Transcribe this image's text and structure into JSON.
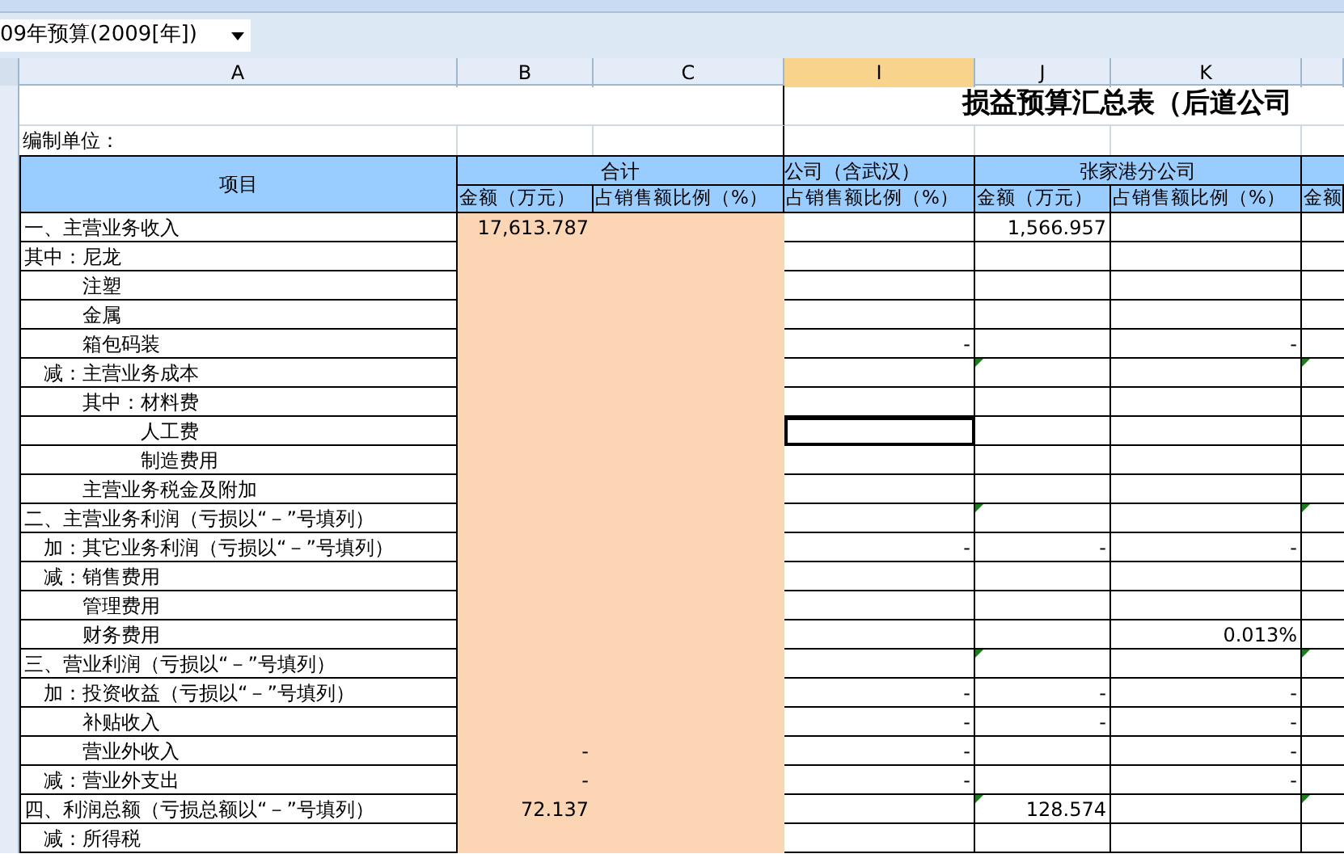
{
  "toolbar": {
    "period_dropdown": "09年预算(2009[年])"
  },
  "column_headers": [
    {
      "label": "A",
      "selected": false
    },
    {
      "label": "B",
      "selected": false
    },
    {
      "label": "C",
      "selected": false
    },
    {
      "label": "I",
      "selected": true
    },
    {
      "label": "J",
      "selected": false
    },
    {
      "label": "K",
      "selected": false
    }
  ],
  "sheet": {
    "title": "损益预算汇总表（后道公司",
    "unit_label": "编制单位：",
    "header": {
      "item": "项目",
      "groups": [
        "合计",
        "公司（含武汉）",
        "张家港分公司"
      ],
      "subheaders": [
        "金额（万元）",
        "占销售额比例（%）",
        "占销售额比例（%）",
        "金额（万元）",
        "占销售额比例（%）",
        "金额"
      ]
    },
    "rows": [
      {
        "item": "一、主营业务收入",
        "kind": "section",
        "flagged": false,
        "B": "17,613.787",
        "J": "1,566.957"
      },
      {
        "item": "其中：尼龙",
        "kind": "section",
        "flagged": false
      },
      {
        "item": "注塑",
        "kind": "detail",
        "flagged": false
      },
      {
        "item": "金属",
        "kind": "detail",
        "flagged": false
      },
      {
        "item": "箱包码装",
        "kind": "detail",
        "flagged": false,
        "I": "-",
        "K": "-"
      },
      {
        "item": "减：主营业务成本",
        "kind": "sub",
        "flagged": true
      },
      {
        "item": "其中：材料费",
        "kind": "detail",
        "flagged": false
      },
      {
        "item": "人工费",
        "kind": "subdetail",
        "flagged": false,
        "selected": true
      },
      {
        "item": "制造费用",
        "kind": "subdetail",
        "flagged": false
      },
      {
        "item": "主营业务税金及附加",
        "kind": "detail",
        "flagged": false
      },
      {
        "item": "二、主营业务利润（亏损以“－”号填列）",
        "kind": "section",
        "flagged": true
      },
      {
        "item": "加：其它业务利润（亏损以“－”号填列）",
        "kind": "sub",
        "flagged": false,
        "I": "-",
        "J": "-",
        "K": "-"
      },
      {
        "item": "减：销售费用",
        "kind": "sub",
        "flagged": false
      },
      {
        "item": "管理费用",
        "kind": "detail",
        "flagged": false
      },
      {
        "item": "财务费用",
        "kind": "detail",
        "flagged": false,
        "K": "0.013%"
      },
      {
        "item": "三、营业利润（亏损以“－”号填列）",
        "kind": "section",
        "flagged": true
      },
      {
        "item": "加：投资收益（亏损以“－”号填列）",
        "kind": "sub",
        "flagged": false,
        "I": "-",
        "J": "-",
        "K": "-"
      },
      {
        "item": "补贴收入",
        "kind": "detail",
        "flagged": false,
        "I": "-",
        "J": "-",
        "K": "-"
      },
      {
        "item": "营业外收入",
        "kind": "detail",
        "flagged": false,
        "B": "-",
        "I": "-",
        "K": "-"
      },
      {
        "item": "减：营业外支出",
        "kind": "sub",
        "flagged": false,
        "B": "-",
        "I": "-",
        "K": "-"
      },
      {
        "item": "四、利润总额（亏损总额以“－”号填列）",
        "kind": "section",
        "flagged": true,
        "B": "72.137",
        "J": "128.574"
      },
      {
        "item": "减：所得税",
        "kind": "sub",
        "flagged": false
      }
    ]
  }
}
